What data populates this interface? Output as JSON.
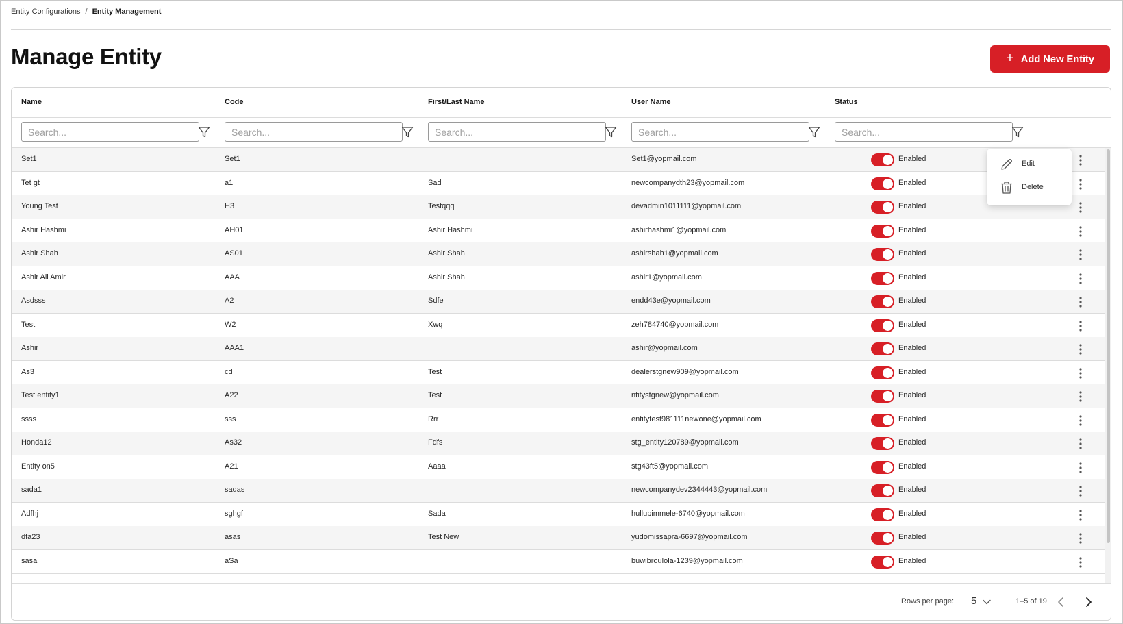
{
  "breadcrumb": [
    "Entity Configurations",
    "Entity Management"
  ],
  "breadcrumb_separator": "/",
  "page_title": "Manage Entity",
  "add_button": {
    "label": "Add New Entity",
    "icon": "plus-icon"
  },
  "colors": {
    "accent": "#d71f26",
    "row_alt": "#f5f5f5",
    "border": "#dcdcdc"
  },
  "columns": [
    "Name",
    "Code",
    "First/Last Name",
    "User Name",
    "Status"
  ],
  "search_placeholder": "Search...",
  "rows": [
    {
      "name": "Set1",
      "code": "Set1",
      "first_last": "",
      "user": "Set1@yopmail.com",
      "status": "Enabled"
    },
    {
      "name": "Tet gt",
      "code": "a1",
      "first_last": "Sad",
      "user": "newcompanydth23@yopmail.com",
      "status": "Enabled"
    },
    {
      "name": "Young Test",
      "code": "H3",
      "first_last": "Testqqq",
      "user": "devadmin1011111@yopmail.com",
      "status": "Enabled"
    },
    {
      "name": "Ashir Hashmi",
      "code": "AH01",
      "first_last": "Ashir Hashmi",
      "user": "ashirhashmi1@yopmail.com",
      "status": "Enabled"
    },
    {
      "name": "Ashir Shah",
      "code": "AS01",
      "first_last": "Ashir Shah",
      "user": "ashirshah1@yopmail.com",
      "status": "Enabled"
    },
    {
      "name": "Ashir Ali Amir",
      "code": "AAA",
      "first_last": "Ashir Shah",
      "user": "ashir1@yopmail.com",
      "status": "Enabled"
    },
    {
      "name": "Asdsss",
      "code": "A2",
      "first_last": "Sdfe",
      "user": "endd43e@yopmail.com",
      "status": "Enabled"
    },
    {
      "name": "Test",
      "code": "W2",
      "first_last": "Xwq",
      "user": "zeh784740@yopmail.com",
      "status": "Enabled"
    },
    {
      "name": "Ashir",
      "code": "AAA1",
      "first_last": "",
      "user": "ashir@yopmail.com",
      "status": "Enabled"
    },
    {
      "name": "As3",
      "code": "cd",
      "first_last": "Test",
      "user": "dealerstgnew909@yopmail.com",
      "status": "Enabled"
    },
    {
      "name": "Test entity1",
      "code": "A22",
      "first_last": "Test",
      "user": "ntitystgnew@yopmail.com",
      "status": "Enabled"
    },
    {
      "name": "ssss",
      "code": "sss",
      "first_last": "Rrr",
      "user": "entitytest981111newone@yopmail.com",
      "status": "Enabled"
    },
    {
      "name": "Honda12",
      "code": "As32",
      "first_last": "Fdfs",
      "user": "stg_entity120789@yopmail.com",
      "status": "Enabled"
    },
    {
      "name": "Entity on5",
      "code": "A21",
      "first_last": "Aaaa",
      "user": "stg43ft5@yopmail.com",
      "status": "Enabled"
    },
    {
      "name": "sada1",
      "code": "sadas",
      "first_last": "",
      "user": "newcompanydev2344443@yopmail.com",
      "status": "Enabled"
    },
    {
      "name": "Adfhj",
      "code": "sghgf",
      "first_last": "Sada",
      "user": "hullubimmele-6740@yopmail.com",
      "status": "Enabled"
    },
    {
      "name": "dfa23",
      "code": "asas",
      "first_last": "Test New",
      "user": "yudomissapra-6697@yopmail.com",
      "status": "Enabled"
    },
    {
      "name": "sasa",
      "code": "aSa",
      "first_last": "",
      "user": "buwibroulola-1239@yopmail.com",
      "status": "Enabled"
    }
  ],
  "context_menu": {
    "edit": "Edit",
    "delete": "Delete"
  },
  "pagination": {
    "rows_per_page_label": "Rows per page:",
    "rows_per_page": "5",
    "range": "1–5 of 19"
  }
}
